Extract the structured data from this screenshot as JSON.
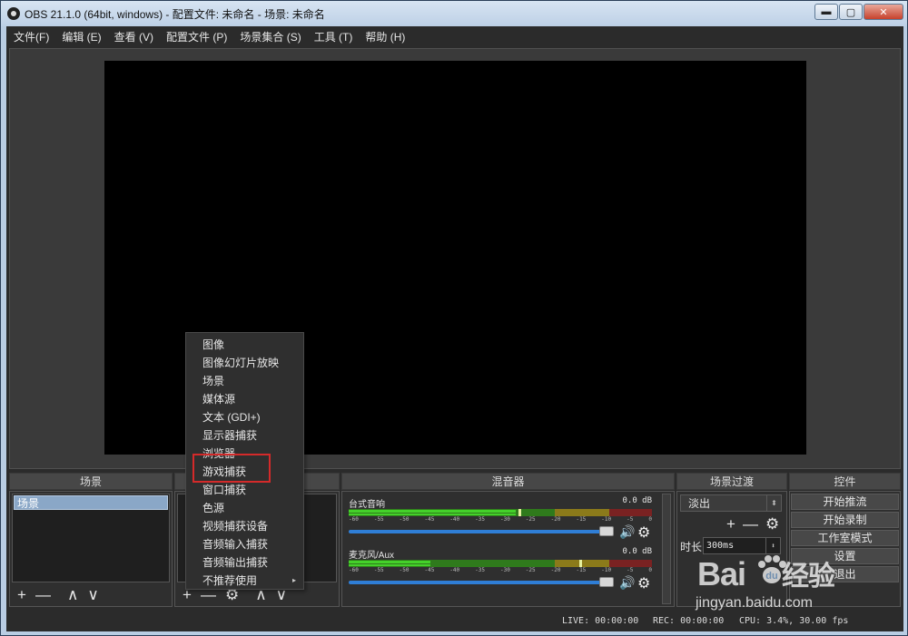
{
  "titlebar": {
    "title": "OBS 21.1.0 (64bit, windows) - 配置文件: 未命名 - 场景: 未命名",
    "minimize": "▬",
    "maximize": "▢",
    "close": "✕"
  },
  "menubar": {
    "items": [
      "文件(F)",
      "编辑 (E)",
      "查看 (V)",
      "配置文件 (P)",
      "场景集合 (S)",
      "工具 (T)",
      "帮助 (H)"
    ]
  },
  "docks": {
    "scenes": {
      "title": "场景",
      "items": [
        "场景"
      ]
    },
    "mixer": {
      "title": "混音器",
      "tracks": [
        {
          "name": "台式音响",
          "db": "0.0 dB",
          "level": 0.55,
          "peak": 0.56
        },
        {
          "name": "麦克风/Aux",
          "db": "0.0 dB",
          "level": 0.27,
          "peak": 0.76
        }
      ],
      "ticks": [
        "-60",
        "-55",
        "-50",
        "-45",
        "-40",
        "-35",
        "-30",
        "-25",
        "-20",
        "-15",
        "-10",
        "-5",
        "0"
      ]
    },
    "transitions": {
      "title": "场景过渡",
      "selected": "淡出",
      "duration_label": "时长",
      "duration_value": "300ms"
    },
    "controls": {
      "title": "控件",
      "buttons": [
        "开始推流",
        "开始录制",
        "工作室模式",
        "设置",
        "退出"
      ]
    }
  },
  "context_menu": {
    "items": [
      "图像",
      "图像幻灯片放映",
      "场景",
      "媒体源",
      "文本 (GDI+)",
      "显示器捕获",
      "浏览器",
      "游戏捕获",
      "窗口捕获",
      "色源",
      "视频捕获设备",
      "音频输入捕获",
      "音频输出捕获",
      "不推荐使用"
    ],
    "highlighted": "游戏捕获"
  },
  "statusbar": {
    "live": "LIVE: 00:00:00",
    "rec": "REC: 00:00:00",
    "cpu": "CPU: 3.4%, 30.00 fps"
  },
  "watermark": {
    "logo": "Bai",
    "logo_suffix": "经验",
    "url": "jingyan.baidu.com"
  },
  "icons": {
    "add": "+",
    "remove": "—",
    "up": "∧",
    "down": "∨",
    "gear": "⚙",
    "speaker": "🔊",
    "submenu": "▸"
  }
}
